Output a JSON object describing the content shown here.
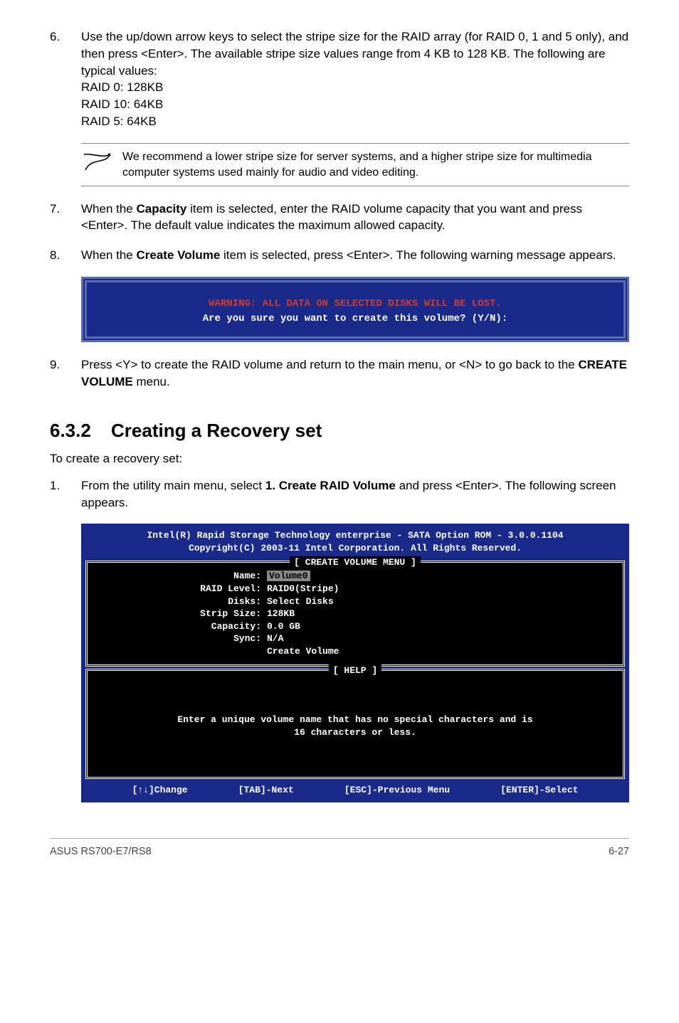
{
  "steps": {
    "s6": {
      "num": "6.",
      "text": "Use the up/down arrow keys to select the stripe size for the RAID array (for RAID 0, 1 and 5 only), and then press <Enter>. The available stripe size values range from 4 KB to 128 KB. The following are typical values:",
      "l1": "RAID 0: 128KB",
      "l2": "RAID 10: 64KB",
      "l3": "RAID 5: 64KB"
    },
    "note": "We recommend a lower stripe size for server systems, and a higher stripe size for multimedia computer systems used mainly for audio and video editing.",
    "s7": {
      "num": "7.",
      "p1": "When the ",
      "b1": "Capacity",
      "p2": " item is selected, enter the RAID volume capacity that you want and press <Enter>. The default value indicates the maximum allowed capacity."
    },
    "s8": {
      "num": "8.",
      "p1": "When the ",
      "b1": "Create Volume",
      "p2": " item is selected, press <Enter>. The following warning message appears."
    },
    "warn_red": "WARNING: ALL DATA ON SELECTED DISKS WILL BE LOST.",
    "warn_white": "Are you sure you want to create this volume? (Y/N):",
    "s9": {
      "num": "9.",
      "p1": "Press <Y> to create the RAID volume and return to the main menu, or <N> to go back to the ",
      "b1": "CREATE VOLUME",
      "p2": " menu."
    }
  },
  "section": {
    "num": "6.3.2",
    "title": "Creating a Recovery set"
  },
  "intro": "To create a recovery set:",
  "steps2": {
    "s1": {
      "num": "1.",
      "p1": "From the utility main menu, select ",
      "b1": "1. Create RAID Volume",
      "p2": " and press <Enter>. The following screen appears."
    }
  },
  "bios": {
    "hdr1": "Intel(R) Rapid Storage Technology enterprise - SATA Option ROM - 3.0.0.1104",
    "hdr2": "Copyright(C) 2003-11 Intel Corporation.  All Rights Reserved.",
    "panel1_title": "[ CREATE VOLUME MENU ]",
    "kv": {
      "name_k": "Name:",
      "name_v": "Volume0",
      "raid_k": "RAID Level:",
      "raid_v": "RAID0(Stripe)",
      "disks_k": "Disks:",
      "disks_v": "Select Disks",
      "strip_k": "Strip Size:",
      "strip_v": " 128KB",
      "cap_k": "Capacity:",
      "cap_v": "0.0   GB",
      "sync_k": "Sync:",
      "sync_v": "N/A",
      "create_v": "Create Volume"
    },
    "panel2_title": "[ HELP ]",
    "help1": "Enter a unique volume name that has no special characters and is",
    "help2": "16 characters or less.",
    "f1": "[↑↓]Change",
    "f2": "[TAB]-Next",
    "f3": "[ESC]-Previous Menu",
    "f4": "[ENTER]-Select"
  },
  "footer": {
    "left": "ASUS RS700-E7/RS8",
    "right": "6-27"
  }
}
